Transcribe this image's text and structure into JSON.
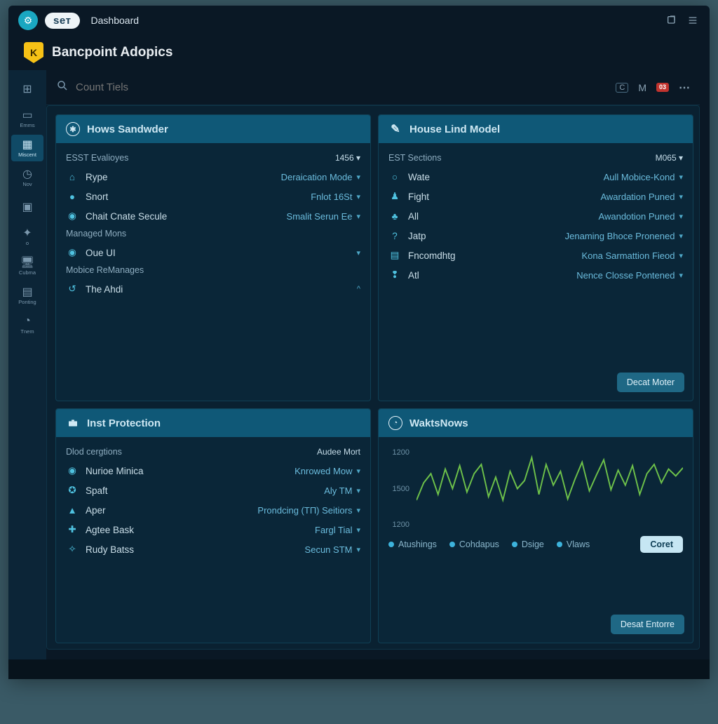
{
  "titlebar": {
    "logo_glyph": "⚙",
    "set_label": "seт",
    "title": "Dashboard"
  },
  "subheader": {
    "shield_glyph": "K",
    "title": "Bancpoint Adopics"
  },
  "search": {
    "placeholder": "Count Tiels"
  },
  "header_right": {
    "letter": "M",
    "badge": "03"
  },
  "sidebar": {
    "items": [
      {
        "glyph": "⊞",
        "label": ""
      },
      {
        "glyph": "▭",
        "label": "Emms"
      },
      {
        "glyph": "▦",
        "label": "Miscent"
      },
      {
        "glyph": "◷",
        "label": "Nov"
      },
      {
        "glyph": "▣",
        "label": ""
      },
      {
        "glyph": "✦",
        "label": "o"
      },
      {
        "glyph": "🖥",
        "label": "Cubma"
      },
      {
        "glyph": "▤",
        "label": "Ponting"
      },
      {
        "glyph": "◔",
        "label": "Tnem"
      }
    ],
    "active_index": 2
  },
  "panel1": {
    "title": "Hows Sandwder",
    "sections": [
      {
        "label": "ESST Evalioyes",
        "badge": "1456",
        "rows": [
          {
            "icon": "home",
            "name": "Rype",
            "value": "Deraication Mode"
          },
          {
            "icon": "drop",
            "name": "Snort",
            "value": "Fnlot 16St"
          },
          {
            "icon": "radio",
            "name": "Chait Cnate Secule",
            "value": "Smalit Serun Ee"
          }
        ]
      },
      {
        "label": "Managed Mons",
        "badge": "",
        "rows": [
          {
            "icon": "radio",
            "name": "Oue UI",
            "value": ""
          }
        ]
      },
      {
        "label": "Mobice ReManages",
        "badge": "",
        "rows": [
          {
            "icon": "loop",
            "name": "The Ahdi",
            "value": "",
            "chev": "^"
          }
        ]
      }
    ]
  },
  "panel2": {
    "title": "House Lind Model",
    "section_label": "EST Sections",
    "badge": "M065",
    "rows": [
      {
        "icon": "dot",
        "name": "Wate",
        "value": "Aull Mobice-Kond"
      },
      {
        "icon": "person",
        "name": "Fight",
        "value": "Awardation Puned"
      },
      {
        "icon": "bulb",
        "name": "All",
        "value": "Awandotion Puned"
      },
      {
        "icon": "help",
        "name": "Jatp",
        "value": "Jenaming Bhoce Pronened"
      },
      {
        "icon": "list",
        "name": "Fncomdhtg",
        "value": "Kona Sarmattion Fieod"
      },
      {
        "icon": "key",
        "name": "At‪l",
        "value": "Nence Closse Pontened"
      }
    ],
    "button": "Decat Moter"
  },
  "panel3": {
    "title": "Inst Protection",
    "section_label": "Dlod cergtions",
    "badge": "Audee Mort",
    "rows": [
      {
        "icon": "radio",
        "name": "Nurioe Minica",
        "value": "Knrowed Mow"
      },
      {
        "icon": "globe",
        "name": "Spaft",
        "value": "Aly TM"
      },
      {
        "icon": "up",
        "name": "Aper",
        "value": "Prondcing (TП) Seitiors"
      },
      {
        "icon": "plus",
        "name": "Agtee Bask",
        "value": "Fargl Tial"
      },
      {
        "icon": "star",
        "name": "Rudy Batss",
        "value": "Secun STM"
      }
    ]
  },
  "panel4": {
    "title": "WaktsNows",
    "legend": [
      {
        "name": "Atushings"
      },
      {
        "name": "Cohdapus"
      },
      {
        "name": "Dsige"
      },
      {
        "name": "Vlaws"
      }
    ],
    "legend_button": "Coret",
    "button": "Desat Entorre"
  },
  "chart_data": {
    "type": "line",
    "title": "WaktsNows",
    "ylabels": [
      "1200",
      "1500",
      "1200"
    ],
    "ylim": [
      1000,
      1700
    ],
    "x": [
      0,
      1,
      2,
      3,
      4,
      5,
      6,
      7,
      8,
      9,
      10,
      11,
      12,
      13,
      14,
      15,
      16,
      17,
      18,
      19,
      20,
      21,
      22,
      23,
      24,
      25,
      26,
      27,
      28,
      29,
      30,
      31,
      32,
      33,
      34,
      35,
      36,
      37
    ],
    "values": [
      1250,
      1400,
      1480,
      1300,
      1520,
      1350,
      1550,
      1320,
      1480,
      1560,
      1280,
      1450,
      1250,
      1500,
      1350,
      1420,
      1620,
      1300,
      1560,
      1380,
      1500,
      1260,
      1430,
      1580,
      1330,
      1470,
      1600,
      1340,
      1510,
      1380,
      1550,
      1300,
      1480,
      1560,
      1400,
      1520,
      1460,
      1530
    ],
    "series_color": "#6ec24a"
  }
}
